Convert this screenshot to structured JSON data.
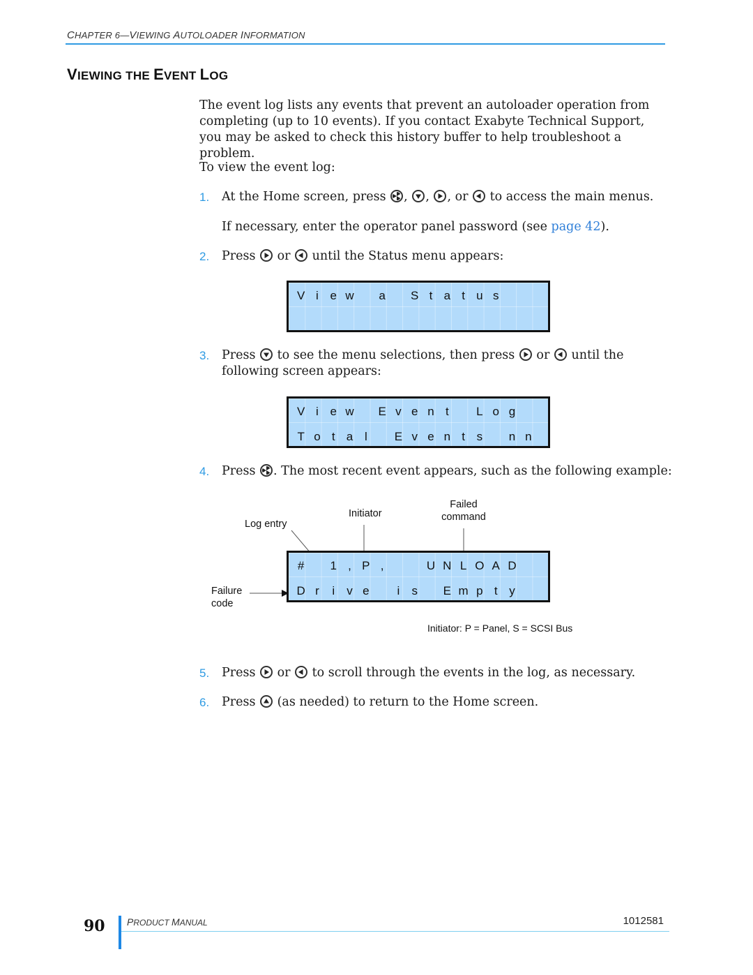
{
  "header": {
    "chapter_prefix": "C",
    "chapter_rest": "HAPTER 6—",
    "chapter_v": "V",
    "chapter_iewing": "IEWING ",
    "chapter_a": "A",
    "chapter_utoloader": "UTOLOADER ",
    "chapter_i": "I",
    "chapter_nformation": "NFORMATION",
    "accent_color": "#2f9be3"
  },
  "section": {
    "title_parts": [
      "V",
      "IEWING THE ",
      "E",
      "VENT ",
      "L",
      "OG"
    ]
  },
  "intro": "The event log lists any events that prevent an autoloader operation from completing (up to 10 events). If you contact Exabyte Technical Support, you may be asked to check this history buffer to help troubleshoot a problem.",
  "to_view": "To view the event log:",
  "steps": [
    {
      "num": "1.",
      "text_a": "At the Home screen, press ",
      "sep1": ", ",
      "sep2": ", ",
      "sep3": ", or ",
      "text_b": " to access the main menus.",
      "icons": [
        "enter-button-icon",
        "down-button-icon",
        "right-button-icon",
        "left-button-icon"
      ]
    },
    {
      "note_a": "If necessary, enter the operator panel password (see ",
      "link": "page 42",
      "note_b": ")."
    },
    {
      "num": "2.",
      "text_a": "Press ",
      "sep1": " or ",
      "text_b": " until the Status menu appears:",
      "icons": [
        "right-button-icon",
        "left-button-icon"
      ]
    },
    {
      "num": "3.",
      "text_a": "Press ",
      "text_mid": " to see the menu selections, then press ",
      "sep1": " or ",
      "text_b": " until the following screen appears:",
      "icons": [
        "down-button-icon",
        "right-button-icon",
        "left-button-icon"
      ]
    },
    {
      "num": "4.",
      "text_a": "Press ",
      "text_b": ". The most recent event appears, such as the following example:",
      "icons": [
        "enter-button-icon"
      ]
    },
    {
      "num": "5.",
      "text_a": "Press ",
      "sep1": " or ",
      "text_b": " to scroll through the events in the log, as necessary.",
      "icons": [
        "right-button-icon",
        "left-button-icon"
      ]
    },
    {
      "num": "6.",
      "text_a": "Press ",
      "text_b": " (as needed) to return to the Home screen.",
      "icons": [
        "up-button-icon"
      ]
    }
  ],
  "lcd_screens": {
    "status": {
      "row1": [
        "V",
        "i",
        "e",
        "w",
        " ",
        "a",
        " ",
        "S",
        "t",
        "a",
        "t",
        "u",
        "s",
        " ",
        " ",
        " "
      ],
      "row2": [
        " ",
        " ",
        " ",
        " ",
        " ",
        " ",
        " ",
        " ",
        " ",
        " ",
        " ",
        " ",
        " ",
        " ",
        " ",
        " "
      ]
    },
    "event_log": {
      "row1": [
        "V",
        "i",
        "e",
        "w",
        " ",
        "E",
        "v",
        "e",
        "n",
        "t",
        " ",
        "L",
        "o",
        "g",
        " ",
        " "
      ],
      "row2": [
        "T",
        "o",
        "t",
        "a",
        "l",
        " ",
        "E",
        "v",
        "e",
        "n",
        "t",
        "s",
        " ",
        "n",
        "n",
        " "
      ]
    },
    "example": {
      "row1": [
        "#",
        " ",
        "1",
        ",",
        "P",
        ",",
        " ",
        " ",
        "U",
        "N",
        "L",
        "O",
        "A",
        "D",
        " ",
        " "
      ],
      "row2": [
        "D",
        "r",
        "i",
        "v",
        "e",
        " ",
        "i",
        "s",
        " ",
        "E",
        "m",
        "p",
        "t",
        "y",
        " ",
        " "
      ]
    },
    "background_color": "#b3dbfb"
  },
  "annotations": {
    "failed_line1": "Failed",
    "failed_line2": "command",
    "initiator": "Initiator",
    "log_entry": "Log entry",
    "failure_line1": "Failure",
    "failure_line2": "code",
    "initiator_note": "Initiator: P = Panel, S = SCSI Bus"
  },
  "footer": {
    "page_number": "90",
    "manual_p": "P",
    "manual_roduct": "RODUCT ",
    "manual_m": "M",
    "manual_anual": "ANUAL",
    "doc_id": "1012581"
  }
}
